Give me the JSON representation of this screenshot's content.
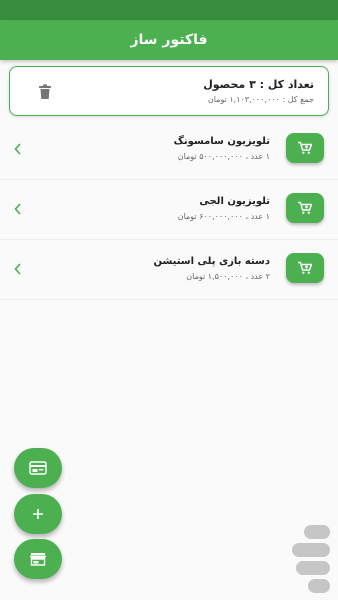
{
  "app": {
    "title": "فاکتور ساز",
    "colors": {
      "primary": "#4caf50",
      "primary_dark": "#388e3c",
      "accent_border": "#4caf50"
    }
  },
  "summary": {
    "count_text": "تعداد کل : ۳ محصول",
    "total_text": "جمع کل : ۱,۱۰۳,۰۰۰,۰۰۰ تومان",
    "delete_icon": "trash-icon"
  },
  "items": [
    {
      "name": "تلویزیون سامسونگ",
      "meta": "۱ عدد ، ۵۰۰,۰۰۰,۰۰۰ تومان"
    },
    {
      "name": "تلویزیون الجی",
      "meta": "۱ عدد ، ۶۰۰,۰۰۰,۰۰۰ تومان"
    },
    {
      "name": "دسته بازی پلی استیشن",
      "meta": "۲ عدد ، ۱,۵۰۰,۰۰۰ تومان"
    }
  ],
  "fabs": {
    "invoice_icon": "invoice-icon",
    "add_icon": "plus-icon",
    "store_icon": "store-icon"
  },
  "watermark": {
    "icon": "store-logo-watermark"
  }
}
